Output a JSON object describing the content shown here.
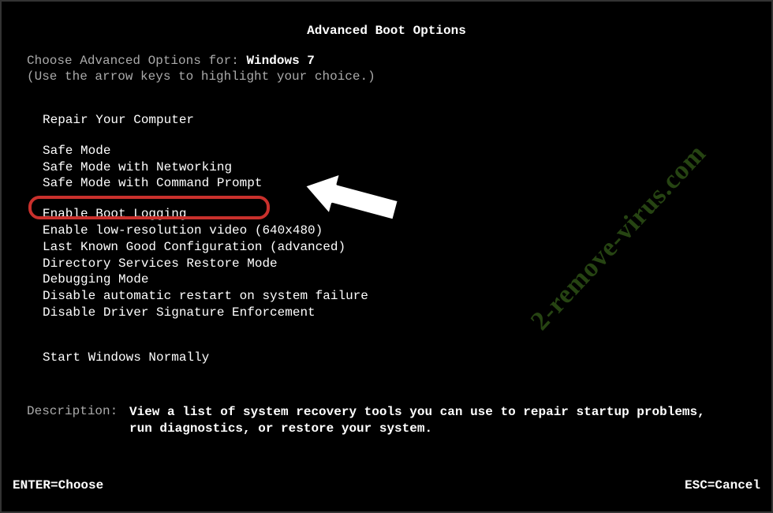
{
  "title": "Advanced Boot Options",
  "choose_prefix": "Choose Advanced Options for: ",
  "os_name": "Windows 7",
  "hint": "(Use the arrow keys to highlight your choice.)",
  "menu": {
    "repair": "Repair Your Computer",
    "safe_mode": "Safe Mode",
    "safe_mode_net": "Safe Mode with Networking",
    "safe_mode_cmd": "Safe Mode with Command Prompt",
    "boot_logging": "Enable Boot Logging",
    "low_res": "Enable low-resolution video (640x480)",
    "last_known": "Last Known Good Configuration (advanced)",
    "ds_restore": "Directory Services Restore Mode",
    "debugging": "Debugging Mode",
    "disable_restart": "Disable automatic restart on system failure",
    "disable_driver_sig": "Disable Driver Signature Enforcement",
    "start_normal": "Start Windows Normally"
  },
  "description_label": "Description:",
  "description_text": "View a list of system recovery tools you can use to repair startup problems, run diagnostics, or restore your system.",
  "footer_left": "ENTER=Choose",
  "footer_right": "ESC=Cancel",
  "watermark": "2-remove-virus.com"
}
